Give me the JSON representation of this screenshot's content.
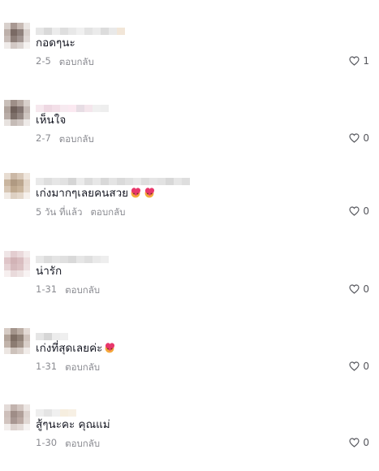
{
  "comments": [
    {
      "text": "กอดๆนะ",
      "date": "2-5",
      "reply": "ตอบกลับ",
      "likes": "1",
      "avatar": [
        "#d8d0cc",
        "#a89892",
        "#c7bab4",
        "#ebe6e3",
        "#bdb0aa",
        "#7a6a64",
        "#8f817c",
        "#d9d1cd",
        "#c8bdb8",
        "#8d7e78",
        "#a19490",
        "#e0d9d6",
        "#f0ecea",
        "#d2c8c4",
        "#dcd5d2",
        "#f5f2f0"
      ],
      "username": [
        "#e6e6e6",
        "#d9d9d9",
        "#ececec",
        "#dedede",
        "#e8e8e8",
        "#f0f0f0",
        "#e3e3e3",
        "#ebebeb",
        "#dcdcdc",
        "#e9e9e9",
        "#f2e6d8"
      ]
    },
    {
      "text": "เห็นใจ",
      "date": "2-7",
      "reply": "ตอบกลับ",
      "likes": "0",
      "avatar": [
        "#c9bfb9",
        "#9e8f88",
        "#b5a8a1",
        "#d8d0cb",
        "#b0a39c",
        "#6f605a",
        "#827470",
        "#c4b9b4",
        "#b9ada7",
        "#7d6f69",
        "#958883",
        "#cfc6c1",
        "#e7e2df",
        "#c5bbb6",
        "#d1c8c4",
        "#eeeae8"
      ],
      "username": [
        "#f6e8ee",
        "#eed8e2",
        "#f3dfe8",
        "#f7eaf0",
        "#fbe9f1",
        "#e7dde4",
        "#f4e6ec",
        "#f0f0f0",
        "#eeeeee"
      ]
    },
    {
      "text": "เก่งมากๆเลยคนสวย",
      "date": "5 วัน ที่แล้ว",
      "reply": "ตอบกลับ",
      "likes": "0",
      "emoji": 2,
      "avatar": [
        "#e7dcd1",
        "#cbb8a6",
        "#d9c9b9",
        "#efe6dd",
        "#c9b59f",
        "#b09a82",
        "#bca78f",
        "#e3d6c8",
        "#d7c6b4",
        "#bfa98f",
        "#c9b49b",
        "#e6dacd",
        "#f1ebe5",
        "#ddd0c2",
        "#e4d8cb",
        "#f6f1ec"
      ],
      "username": [
        "#e9e9e9",
        "#dedede",
        "#e6e6e6",
        "#e2e2e2",
        "#d5d5d5",
        "#ebebeb",
        "#dcdcdc",
        "#e7e7e7",
        "#d8d8d8",
        "#e4e4e4",
        "#dadada",
        "#e1e1e1",
        "#e9e9e9",
        "#dedede",
        "#e6e6e6",
        "#e2e2e2",
        "#d8d8d8",
        "#e6e6e6",
        "#dedede"
      ]
    },
    {
      "text": "น่ารัก",
      "date": "1-31",
      "reply": "ตอบกลับ",
      "likes": "0",
      "avatar": [
        "#efe5e6",
        "#e3cdd0",
        "#ead9db",
        "#f4ecec",
        "#dfc5c8",
        "#d2b3b6",
        "#d9bdc0",
        "#ecdcdd",
        "#e6d3d5",
        "#d6babd",
        "#dcc2c4",
        "#eee0e1",
        "#f6efef",
        "#e9dadb",
        "#eee3e3",
        "#f8f3f3"
      ],
      "username": [
        "#e8e8e8",
        "#dcdcdc",
        "#e4e4e4",
        "#e0e0e0",
        "#d9d9d9",
        "#e6e6e6",
        "#dfdfdf",
        "#e9e9e9",
        "#eeeeee"
      ]
    },
    {
      "text": "เก่งที่สุดเลยค่ะ",
      "date": "1-31",
      "reply": "ตอบกลับ",
      "likes": "0",
      "emoji": 1,
      "avatar": [
        "#d6cbc4",
        "#a4958c",
        "#bcaea5",
        "#e3dad5",
        "#b3a49a",
        "#7e6e64",
        "#918278",
        "#cfc3bc",
        "#c1b3aa",
        "#8c7c72",
        "#a29389",
        "#d9cfc9",
        "#ece6e2",
        "#cdc2bb",
        "#d8cec8",
        "#f1ece9"
      ],
      "username": [
        "#e5e5e5",
        "#d6d6d6",
        "#ececec",
        "#efefef"
      ]
    },
    {
      "text": "สู้ๆนะคะ คุณแม่",
      "date": "1-30",
      "reply": "ตอบกลับ",
      "likes": "0",
      "avatar": [
        "#e3dbd8",
        "#c2b3ae",
        "#d3c7c2",
        "#ece6e3",
        "#cdbfba",
        "#9f8d87",
        "#b09f99",
        "#ddd3cf",
        "#d1c4bf",
        "#a89792",
        "#bba9a3",
        "#e1d8d4",
        "#f2eeec",
        "#dcd3cf",
        "#e4dcd9",
        "#f6f3f2"
      ],
      "username": [
        "#eeeeee",
        "#e4e4e4",
        "#f0f0f0",
        "#f6eedf",
        "#f7f0e4"
      ]
    }
  ]
}
